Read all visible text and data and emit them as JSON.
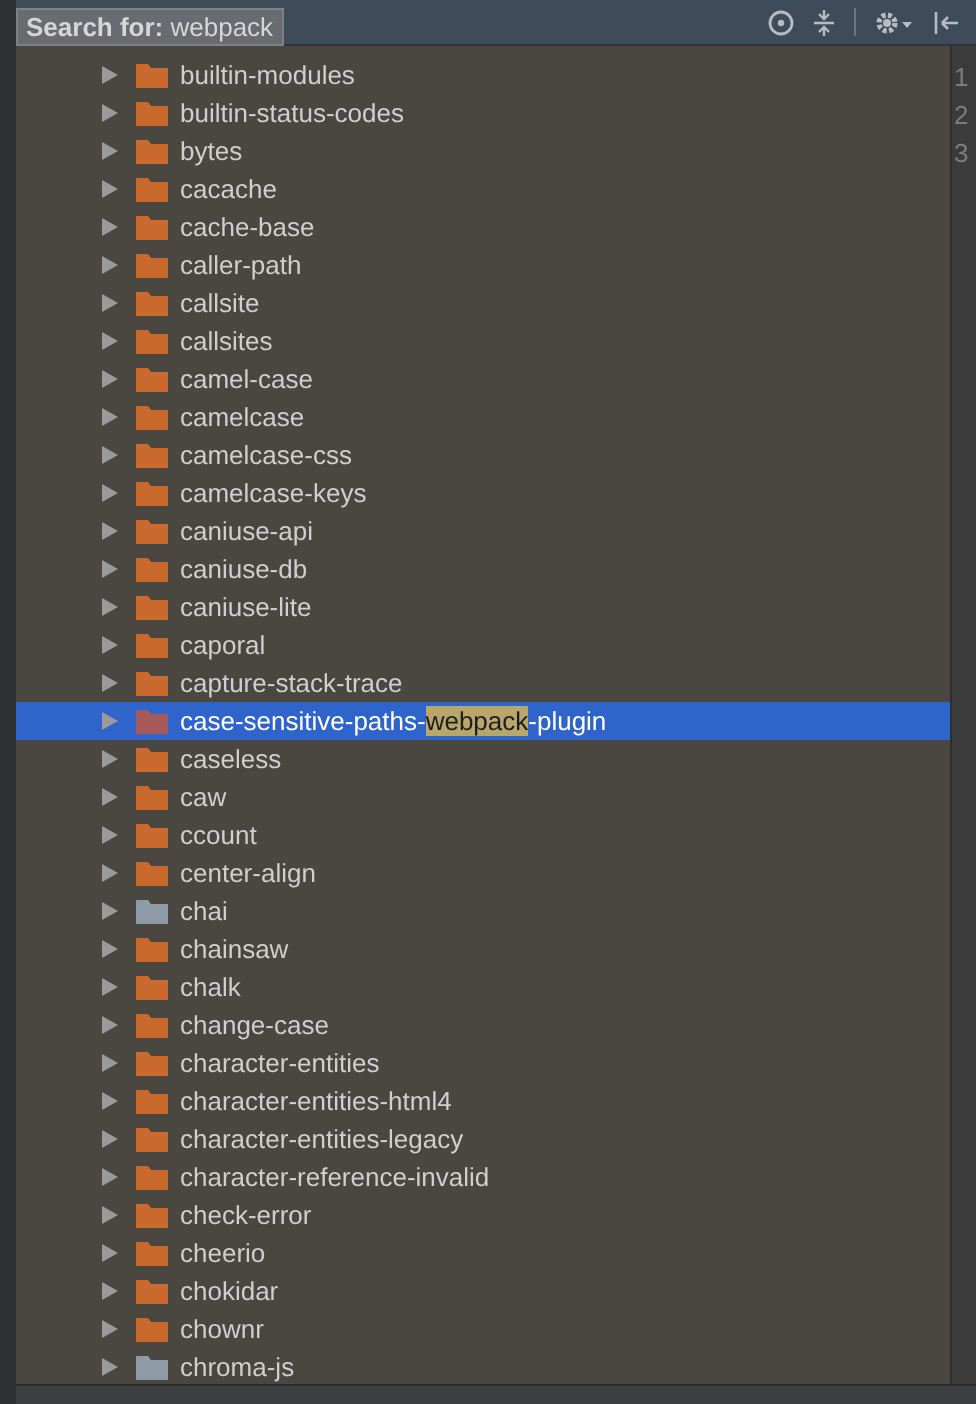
{
  "search": {
    "text": "**Search for:** webpack"
  },
  "gutter": [
    "1",
    "2",
    "3"
  ],
  "tree": [
    {
      "label": "builtin-modules",
      "color": "#c9692d",
      "selected": false
    },
    {
      "label": "builtin-status-codes",
      "color": "#c9692d",
      "selected": false
    },
    {
      "label": "bytes",
      "color": "#c9692d",
      "selected": false
    },
    {
      "label": "cacache",
      "color": "#c9692d",
      "selected": false
    },
    {
      "label": "cache-base",
      "color": "#c9692d",
      "selected": false
    },
    {
      "label": "caller-path",
      "color": "#c9692d",
      "selected": false
    },
    {
      "label": "callsite",
      "color": "#c9692d",
      "selected": false
    },
    {
      "label": "callsites",
      "color": "#c9692d",
      "selected": false
    },
    {
      "label": "camel-case",
      "color": "#c9692d",
      "selected": false
    },
    {
      "label": "camelcase",
      "color": "#c9692d",
      "selected": false
    },
    {
      "label": "camelcase-css",
      "color": "#c9692d",
      "selected": false
    },
    {
      "label": "camelcase-keys",
      "color": "#c9692d",
      "selected": false
    },
    {
      "label": "caniuse-api",
      "color": "#c9692d",
      "selected": false
    },
    {
      "label": "caniuse-db",
      "color": "#c9692d",
      "selected": false
    },
    {
      "label": "caniuse-lite",
      "color": "#c9692d",
      "selected": false
    },
    {
      "label": "caporal",
      "color": "#c9692d",
      "selected": false
    },
    {
      "label": "capture-stack-trace",
      "color": "#c9692d",
      "selected": false
    },
    {
      "label": "case-sensitive-paths-",
      "match": "webpack",
      "label_after": "-plugin",
      "color": "#a85a5a",
      "selected": true
    },
    {
      "label": "caseless",
      "color": "#c9692d",
      "selected": false
    },
    {
      "label": "caw",
      "color": "#c9692d",
      "selected": false
    },
    {
      "label": "ccount",
      "color": "#c9692d",
      "selected": false
    },
    {
      "label": "center-align",
      "color": "#c9692d",
      "selected": false
    },
    {
      "label": "chai",
      "color": "#8e9aa5",
      "selected": false
    },
    {
      "label": "chainsaw",
      "color": "#c9692d",
      "selected": false
    },
    {
      "label": "chalk",
      "color": "#c9692d",
      "selected": false
    },
    {
      "label": "change-case",
      "color": "#c9692d",
      "selected": false
    },
    {
      "label": "character-entities",
      "color": "#c9692d",
      "selected": false
    },
    {
      "label": "character-entities-html4",
      "color": "#c9692d",
      "selected": false
    },
    {
      "label": "character-entities-legacy",
      "color": "#c9692d",
      "selected": false
    },
    {
      "label": "character-reference-invalid",
      "color": "#c9692d",
      "selected": false
    },
    {
      "label": "check-error",
      "color": "#c9692d",
      "selected": false
    },
    {
      "label": "cheerio",
      "color": "#c9692d",
      "selected": false
    },
    {
      "label": "chokidar",
      "color": "#c9692d",
      "selected": false
    },
    {
      "label": "chownr",
      "color": "#c9692d",
      "selected": false
    },
    {
      "label": "chroma-js",
      "color": "#8e9aa5",
      "selected": false
    }
  ]
}
